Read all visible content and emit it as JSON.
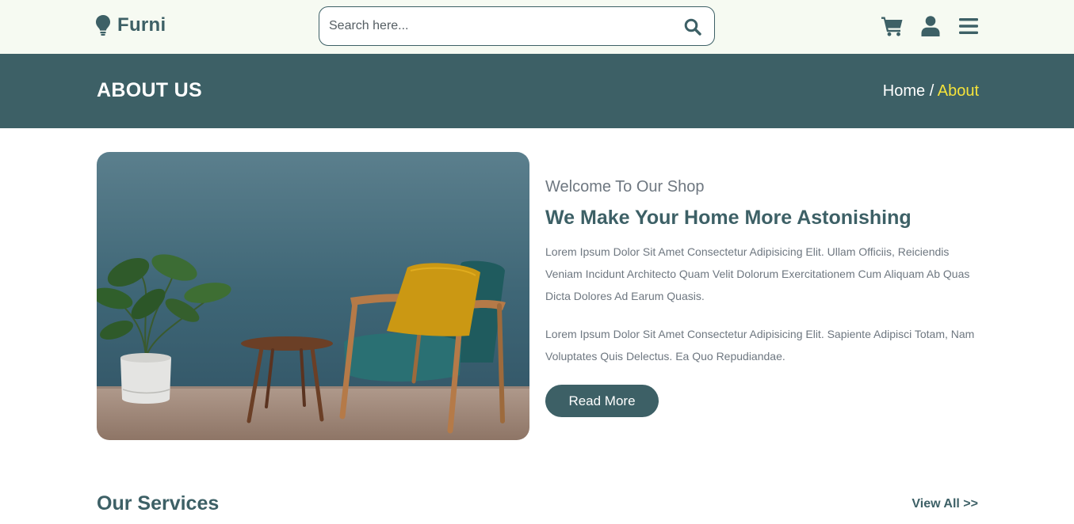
{
  "header": {
    "brand": "Furni",
    "search": {
      "placeholder": "Search here...",
      "value": ""
    },
    "icons": [
      "cart-icon",
      "user-icon",
      "menu-icon"
    ]
  },
  "banner": {
    "title": "ABOUT US",
    "breadcrumb": {
      "home": "Home",
      "separator": " / ",
      "current": "About"
    }
  },
  "about": {
    "subtitle": "Welcome To Our Shop",
    "heading": "We Make Your Home More Astonishing",
    "paragraph1": "Lorem Ipsum Dolor Sit Amet Consectetur Adipisicing Elit. Ullam Officiis, Reiciendis Veniam Incidunt Architecto Quam Velit Dolorum Exercitationem Cum Aliquam Ab Quas Dicta Dolores Ad Earum Quasis.",
    "paragraph2": "Lorem Ipsum Dolor Sit Amet Consectetur Adipisicing Elit. Sapiente Adipisci Totam, Nam Voluptates Quis Delectus. Ea Quo Repudiandae.",
    "button_label": "Read More"
  },
  "services": {
    "title": "Our Services",
    "view_all": "View All >>"
  },
  "colors": {
    "primary": "#3d6066",
    "header_bg": "#f6faf2",
    "breadcrumb_active": "#f5e33a",
    "muted_text": "#6e7780"
  }
}
